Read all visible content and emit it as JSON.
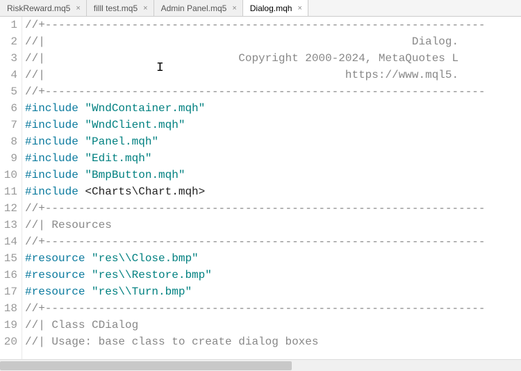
{
  "tabs": [
    {
      "label": "RiskReward.mq5",
      "active": false
    },
    {
      "label": "filll test.mq5",
      "active": false
    },
    {
      "label": "Admin Panel.mq5",
      "active": false
    },
    {
      "label": "Dialog.mqh",
      "active": true
    }
  ],
  "lines": [
    {
      "n": "1",
      "segs": [
        {
          "cls": "tok-comment",
          "text": "//+------------------------------------------------------------------"
        }
      ]
    },
    {
      "n": "2",
      "segs": [
        {
          "cls": "tok-comment",
          "text": "//|                                                       Dialog."
        }
      ]
    },
    {
      "n": "3",
      "segs": [
        {
          "cls": "tok-comment",
          "text": "//|                             Copyright 2000-2024, MetaQuotes L"
        }
      ]
    },
    {
      "n": "4",
      "segs": [
        {
          "cls": "tok-comment",
          "text": "//|                                             https://www.mql5."
        }
      ]
    },
    {
      "n": "5",
      "segs": [
        {
          "cls": "tok-comment",
          "text": "//+------------------------------------------------------------------"
        }
      ]
    },
    {
      "n": "6",
      "segs": [
        {
          "cls": "tok-keyword",
          "text": "#include "
        },
        {
          "cls": "tok-string",
          "text": "\"WndContainer.mqh\""
        }
      ]
    },
    {
      "n": "7",
      "segs": [
        {
          "cls": "tok-keyword",
          "text": "#include "
        },
        {
          "cls": "tok-string",
          "text": "\"WndClient.mqh\""
        }
      ]
    },
    {
      "n": "8",
      "segs": [
        {
          "cls": "tok-keyword",
          "text": "#include "
        },
        {
          "cls": "tok-string",
          "text": "\"Panel.mqh\""
        }
      ]
    },
    {
      "n": "9",
      "segs": [
        {
          "cls": "tok-keyword",
          "text": "#include "
        },
        {
          "cls": "tok-string",
          "text": "\"Edit.mqh\""
        }
      ]
    },
    {
      "n": "10",
      "segs": [
        {
          "cls": "tok-keyword",
          "text": "#include "
        },
        {
          "cls": "tok-string",
          "text": "\"BmpButton.mqh\""
        }
      ]
    },
    {
      "n": "11",
      "segs": [
        {
          "cls": "tok-keyword",
          "text": "#include "
        },
        {
          "cls": "tok-plain",
          "text": "<Charts\\Chart.mqh>"
        }
      ]
    },
    {
      "n": "12",
      "segs": [
        {
          "cls": "tok-comment",
          "text": "//+------------------------------------------------------------------"
        }
      ]
    },
    {
      "n": "13",
      "segs": [
        {
          "cls": "tok-comment",
          "text": "//| Resources                                                        "
        }
      ]
    },
    {
      "n": "14",
      "segs": [
        {
          "cls": "tok-comment",
          "text": "//+------------------------------------------------------------------"
        }
      ]
    },
    {
      "n": "15",
      "segs": [
        {
          "cls": "tok-keyword",
          "text": "#resource "
        },
        {
          "cls": "tok-string",
          "text": "\"res\\\\Close.bmp\""
        }
      ]
    },
    {
      "n": "16",
      "segs": [
        {
          "cls": "tok-keyword",
          "text": "#resource "
        },
        {
          "cls": "tok-string",
          "text": "\"res\\\\Restore.bmp\""
        }
      ]
    },
    {
      "n": "17",
      "segs": [
        {
          "cls": "tok-keyword",
          "text": "#resource "
        },
        {
          "cls": "tok-string",
          "text": "\"res\\\\Turn.bmp\""
        }
      ]
    },
    {
      "n": "18",
      "segs": [
        {
          "cls": "tok-comment",
          "text": "//+------------------------------------------------------------------"
        }
      ]
    },
    {
      "n": "19",
      "segs": [
        {
          "cls": "tok-comment",
          "text": "//| Class CDialog                                                    "
        }
      ]
    },
    {
      "n": "20",
      "segs": [
        {
          "cls": "tok-comment",
          "text": "//| Usage: base class to create dialog boxes                         "
        }
      ]
    }
  ],
  "close_glyph": "×"
}
